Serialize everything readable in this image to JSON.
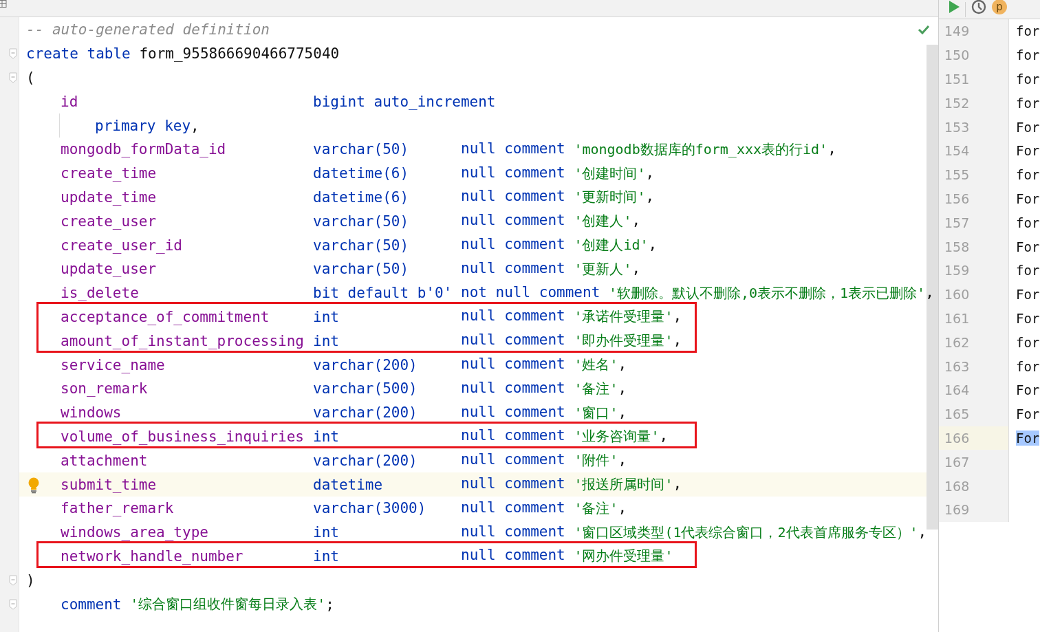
{
  "editor": {
    "lines": [
      {
        "kind": "comment",
        "text": "-- auto-generated definition"
      },
      {
        "kind": "create",
        "fold": true,
        "keyword": "create table",
        "name": "form_955866690466775040"
      },
      {
        "kind": "open",
        "fold": true,
        "text": "("
      },
      {
        "kind": "column",
        "name": "id",
        "type": "bigint auto_increment"
      },
      {
        "kind": "continuation",
        "text": "primary key",
        "punct": ","
      },
      {
        "kind": "column",
        "name": "mongodb_formData_id",
        "type": "varchar(50)",
        "modifier": "null comment",
        "comment": "'mongodb数据库的form_xxx表的行id'",
        "punct": ","
      },
      {
        "kind": "column",
        "name": "create_time",
        "type": "datetime(6)",
        "modifier": "null comment",
        "comment": "'创建时间'",
        "punct": ","
      },
      {
        "kind": "column",
        "name": "update_time",
        "type": "datetime(6)",
        "modifier": "null comment",
        "comment": "'更新时间'",
        "punct": ","
      },
      {
        "kind": "column",
        "name": "create_user",
        "type": "varchar(50)",
        "modifier": "null comment",
        "comment": "'创建人'",
        "punct": ","
      },
      {
        "kind": "column",
        "name": "create_user_id",
        "type": "varchar(50)",
        "modifier": "null comment",
        "comment": "'创建人id'",
        "punct": ","
      },
      {
        "kind": "column",
        "name": "update_user",
        "type": "varchar(50)",
        "modifier": "null comment",
        "comment": "'更新人'",
        "punct": ","
      },
      {
        "kind": "column",
        "name": "is_delete",
        "type": "bit default b'0'",
        "modifier": "not null comment",
        "comment": "'软删除。默认不删除,0表示不删除，1表示已删除'",
        "punct": ","
      },
      {
        "kind": "column",
        "name": "acceptance_of_commitment",
        "type": "int",
        "modifier": "null comment",
        "comment": "'承诺件受理量'",
        "punct": ",",
        "boxed": true
      },
      {
        "kind": "column",
        "name": "amount_of_instant_processing",
        "type": "int",
        "modifier": "null comment",
        "comment": "'即办件受理量'",
        "punct": ",",
        "boxed": true
      },
      {
        "kind": "column",
        "name": "service_name",
        "type": "varchar(200)",
        "modifier": "null comment",
        "comment": "'姓名'",
        "punct": ","
      },
      {
        "kind": "column",
        "name": "son_remark",
        "type": "varchar(500)",
        "modifier": "null comment",
        "comment": "'备注'",
        "punct": ","
      },
      {
        "kind": "column",
        "name": "windows",
        "type": "varchar(200)",
        "modifier": "null comment",
        "comment": "'窗口'",
        "punct": ","
      },
      {
        "kind": "column",
        "name": "volume_of_business_inquiries",
        "type": "int",
        "modifier": "null comment",
        "comment": "'业务咨询量'",
        "punct": ",",
        "boxed": true
      },
      {
        "kind": "column",
        "name": "attachment",
        "type": "varchar(200)",
        "modifier": "null comment",
        "comment": "'附件'",
        "punct": ","
      },
      {
        "kind": "column",
        "name": "submit_time",
        "type": "datetime",
        "modifier": "null comment",
        "comment": "'报送所属时间'",
        "punct": ",",
        "current": true
      },
      {
        "kind": "column",
        "name": "father_remark",
        "type": "varchar(3000)",
        "modifier": "null comment",
        "comment": "'备注'",
        "punct": ","
      },
      {
        "kind": "column",
        "name": "windows_area_type",
        "type": "int",
        "modifier": "null comment",
        "comment": "'窗口区域类型(1代表综合窗口，2代表首席服务专区）'",
        "punct": ","
      },
      {
        "kind": "column",
        "name": "network_handle_number",
        "type": "int",
        "modifier": "null comment",
        "comment": "'网办件受理量'",
        "boxed": true
      },
      {
        "kind": "close",
        "fold": true,
        "text": ")"
      },
      {
        "kind": "table_comment",
        "fold": true,
        "keyword": "comment",
        "comment": "'综合窗口组收件窗每日录入表'",
        "punct": ";"
      }
    ]
  },
  "side_panel": {
    "rows": [
      {
        "number": "149",
        "text": "for",
        "selected": false
      },
      {
        "number": "150",
        "text": "for",
        "selected": false
      },
      {
        "number": "151",
        "text": "for",
        "selected": false
      },
      {
        "number": "152",
        "text": "for",
        "selected": false
      },
      {
        "number": "153",
        "text": "For",
        "selected": false
      },
      {
        "number": "154",
        "text": "For",
        "selected": false
      },
      {
        "number": "155",
        "text": "for",
        "selected": false
      },
      {
        "number": "156",
        "text": "For",
        "selected": false
      },
      {
        "number": "157",
        "text": "for",
        "selected": false
      },
      {
        "number": "158",
        "text": "For",
        "selected": false
      },
      {
        "number": "159",
        "text": "for",
        "selected": false
      },
      {
        "number": "160",
        "text": "For",
        "selected": false
      },
      {
        "number": "161",
        "text": "For",
        "selected": false
      },
      {
        "number": "162",
        "text": "for",
        "selected": false
      },
      {
        "number": "163",
        "text": "for",
        "selected": false
      },
      {
        "number": "164",
        "text": "For",
        "selected": false
      },
      {
        "number": "165",
        "text": "For",
        "selected": false
      },
      {
        "number": "166",
        "text": "For",
        "selected": true
      },
      {
        "number": "167",
        "selected": false
      },
      {
        "number": "168",
        "selected": false
      },
      {
        "number": "169",
        "selected": false
      }
    ],
    "avatar": "p"
  }
}
